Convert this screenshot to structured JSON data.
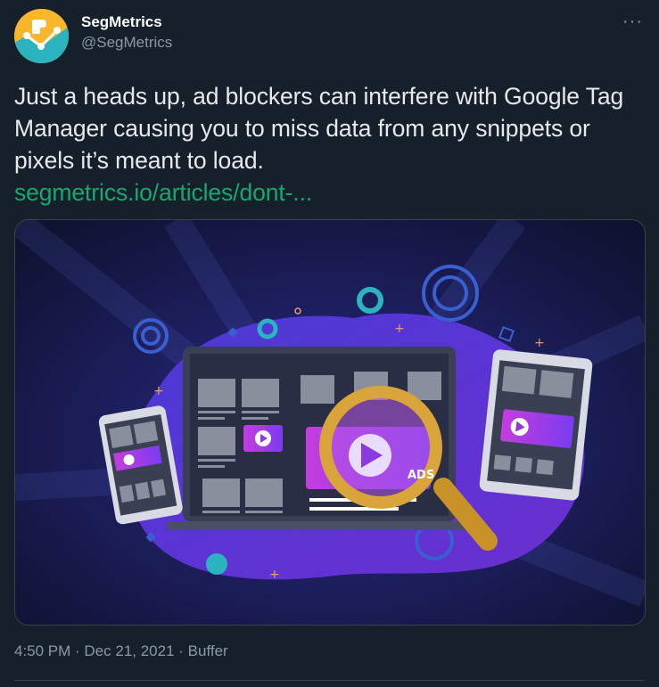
{
  "author": {
    "name": "SegMetrics",
    "handle": "@SegMetrics"
  },
  "more_label": "···",
  "tweet": {
    "text": "Just a heads up, ad blockers can interfere with Google Tag Manager causing you to miss data from any snippets or pixels it’s meant to load.",
    "link": "segmetrics.io/articles/dont-..."
  },
  "media": {
    "ad_label": "ADS"
  },
  "meta": {
    "time": "4:50 PM",
    "sep1": " · ",
    "date": "Dec 21, 2021",
    "sep2": " · ",
    "source": "Buffer"
  },
  "colors": {
    "background": "#15202b",
    "link": "#17a870",
    "secondary_text": "#8b98a5",
    "avatar_bg": "#f8b62d"
  }
}
